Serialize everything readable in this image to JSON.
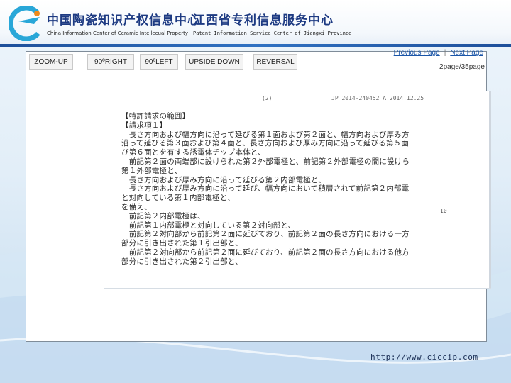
{
  "header": {
    "left_org_cn": "中国陶瓷知识产权信息中心",
    "left_org_en": "China Information Center of Ceramic Intellecual Property",
    "right_org_cn": "江西省专利信息服务中心",
    "right_org_en": "Patent Information Service Center of Jiangxi Province",
    "colors": {
      "title_blue": "#1d3a82",
      "rule_blue": "#2f71c2",
      "logo_cyan": "#29a7d8",
      "logo_orange": "#f08a1c"
    }
  },
  "toolbar": {
    "zoom_up": "ZOOM-UP",
    "rotate_right": "90ºRIGHT",
    "rotate_left": "90ºLEFT",
    "upside_down": "UPSIDE DOWN",
    "reversal": "REVERSAL"
  },
  "pager": {
    "previous": "Previous Page",
    "separator": "|",
    "next": "Next Page",
    "count": "2page/35page"
  },
  "document": {
    "page_marker": "(2)",
    "header_ref": "JP 2014-240452 A 2014.12.25",
    "margin_line_no": "10",
    "lines": [
      "【特許請求の範囲】",
      "【請求項１】",
      "　長さ方向および幅方向に沿って延びる第１面および第２面と、幅方向および厚み方向に",
      "沿って延びる第３面および第４面と、長さ方向および厚み方向に沿って延びる第５面およ",
      "び第６面とを有する誘電体チップ本体と、",
      "　前記第２面の両端部に設けられた第２外部電極と、前記第２外部電極の間に設けられた",
      "第１外部電極と、",
      "　長さ方向および厚み方向に沿って延びる第２内部電極と、",
      "　長さ方向および厚み方向に沿って延び、幅方向において積層されて前記第２内部電極",
      "と対向している第１内部電極と、",
      "を備え、",
      "　前記第２内部電極は、",
      "　前記第１内部電極と対向している第２対向部と、",
      "　前記第２対向部から前記第２面に延びており、前記第２面の長さ方向における一方側",
      "部分に引き出された第１引出部と、",
      "　前記第２対向部から前記第２面に延びており、前記第２面の長さ方向における他方側",
      "部分に引き出された第２引出部と、"
    ]
  },
  "footer": {
    "url": "http://www.ciccip.com"
  }
}
